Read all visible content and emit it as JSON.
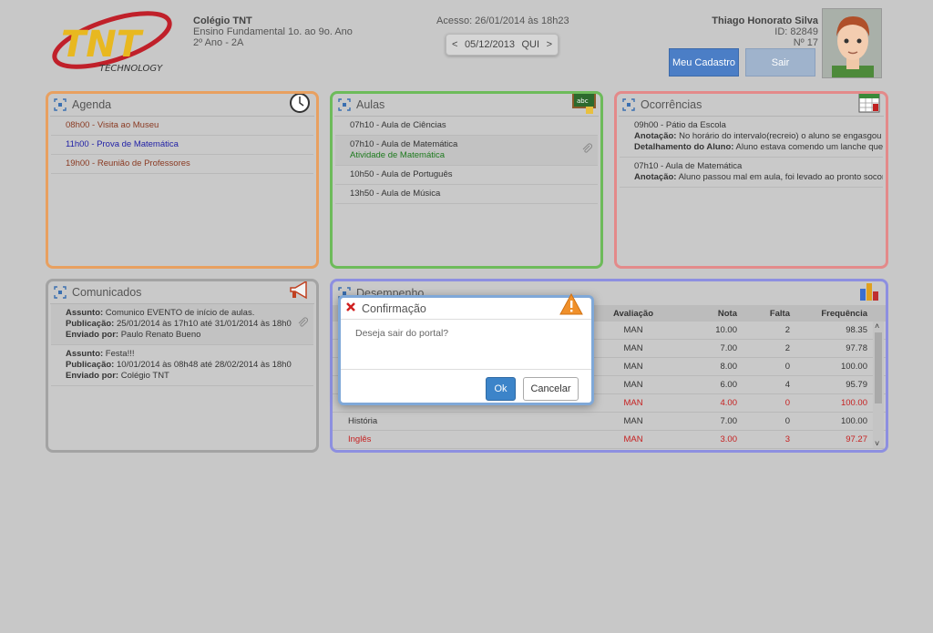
{
  "logo": {
    "big": "TNT",
    "sub": "TECHNOLOGY"
  },
  "school": {
    "name": "Colégio TNT",
    "level": "Ensino Fundamental 1o. ao 9o. Ano",
    "class": "2º Ano - 2A"
  },
  "access": "Acesso: 26/01/2014 às 18h23",
  "date_nav": {
    "prev": "<",
    "date": "05/12/2013",
    "weekday": "QUI",
    "next": ">"
  },
  "user": {
    "name": "Thiago Honorato Silva",
    "id": "ID: 82849",
    "number": "Nº 17"
  },
  "buttons": {
    "profile": "Meu Cadastro",
    "logout": "Sair"
  },
  "agenda": {
    "title": "Agenda",
    "items": [
      "08h00 - Visita ao Museu",
      "11h00 - Prova de Matemática",
      "19h00 - Reunião de Professores"
    ]
  },
  "aulas": {
    "title": "Aulas",
    "items": [
      {
        "text": "07h10 - Aula de Ciências"
      },
      {
        "text": "07h10 - Aula de Matemática",
        "sub": "Atividade de Matemática"
      },
      {
        "text": "10h50 - Aula de Português"
      },
      {
        "text": "13h50 - Aula de Música"
      }
    ]
  },
  "ocorrencias": {
    "title": "Ocorrências",
    "items": [
      {
        "head": "09h00 - Pátio da Escola",
        "l1k": "Anotação:",
        "l1v": " No horário do intervalo(recreio) o aluno se engasgou c",
        "l2k": "Detalhamento do Aluno:",
        "l2v": " Aluno estava comendo um lanche que t"
      },
      {
        "head": "07h10 - Aula de Matemática",
        "l1k": "Anotação:",
        "l1v": " Aluno passou mal em aula, foi levado ao pronto socorr"
      }
    ]
  },
  "comunicados": {
    "title": "Comunicados",
    "items": [
      {
        "a_k": "Assunto:",
        "a_v": " Comunico EVENTO de início de aulas.",
        "p_k": "Publicação:",
        "p_v": " 25/01/2014 às 17h10 até 31/01/2014 às 18h0",
        "e_k": "Enviado por:",
        "e_v": " Paulo Renato Bueno"
      },
      {
        "a_k": "Assunto:",
        "a_v": " Festa!!!",
        "p_k": "Publicação:",
        "p_v": " 10/01/2014 às 08h48 até 28/02/2014 às 18h0",
        "e_k": "Enviado por:",
        "e_v": " Colégio TNT"
      }
    ]
  },
  "desempenho": {
    "title": "Desempenho",
    "headers": [
      "",
      "Avaliação",
      "Nota",
      "Falta",
      "Frequência"
    ],
    "rows": [
      {
        "subj": "",
        "av": "MAN",
        "nota": "10.00",
        "falta": "2",
        "freq": "98.35",
        "red": false
      },
      {
        "subj": "",
        "av": "MAN",
        "nota": "7.00",
        "falta": "2",
        "freq": "97.78",
        "red": false
      },
      {
        "subj": "",
        "av": "MAN",
        "nota": "8.00",
        "falta": "0",
        "freq": "100.00",
        "red": false
      },
      {
        "subj": "",
        "av": "MAN",
        "nota": "6.00",
        "falta": "4",
        "freq": "95.79",
        "red": false
      },
      {
        "subj": "",
        "av": "MAN",
        "nota": "4.00",
        "falta": "0",
        "freq": "100.00",
        "red": true
      },
      {
        "subj": "História",
        "av": "MAN",
        "nota": "7.00",
        "falta": "0",
        "freq": "100.00",
        "red": false
      },
      {
        "subj": "Inglês",
        "av": "MAN",
        "nota": "3.00",
        "falta": "3",
        "freq": "97.27",
        "red": true
      }
    ]
  },
  "dialog": {
    "title": "Confirmação",
    "message": "Deseja sair do portal?",
    "ok": "Ok",
    "cancel": "Cancelar"
  },
  "colors": {
    "agenda": "#e8a060",
    "aulas": "#6dbb5a",
    "ocorrencias": "#e38a8a",
    "comunicados": "#a3a3a3",
    "desempenho": "#8d8fe0",
    "accent": "#4b7ec6"
  }
}
